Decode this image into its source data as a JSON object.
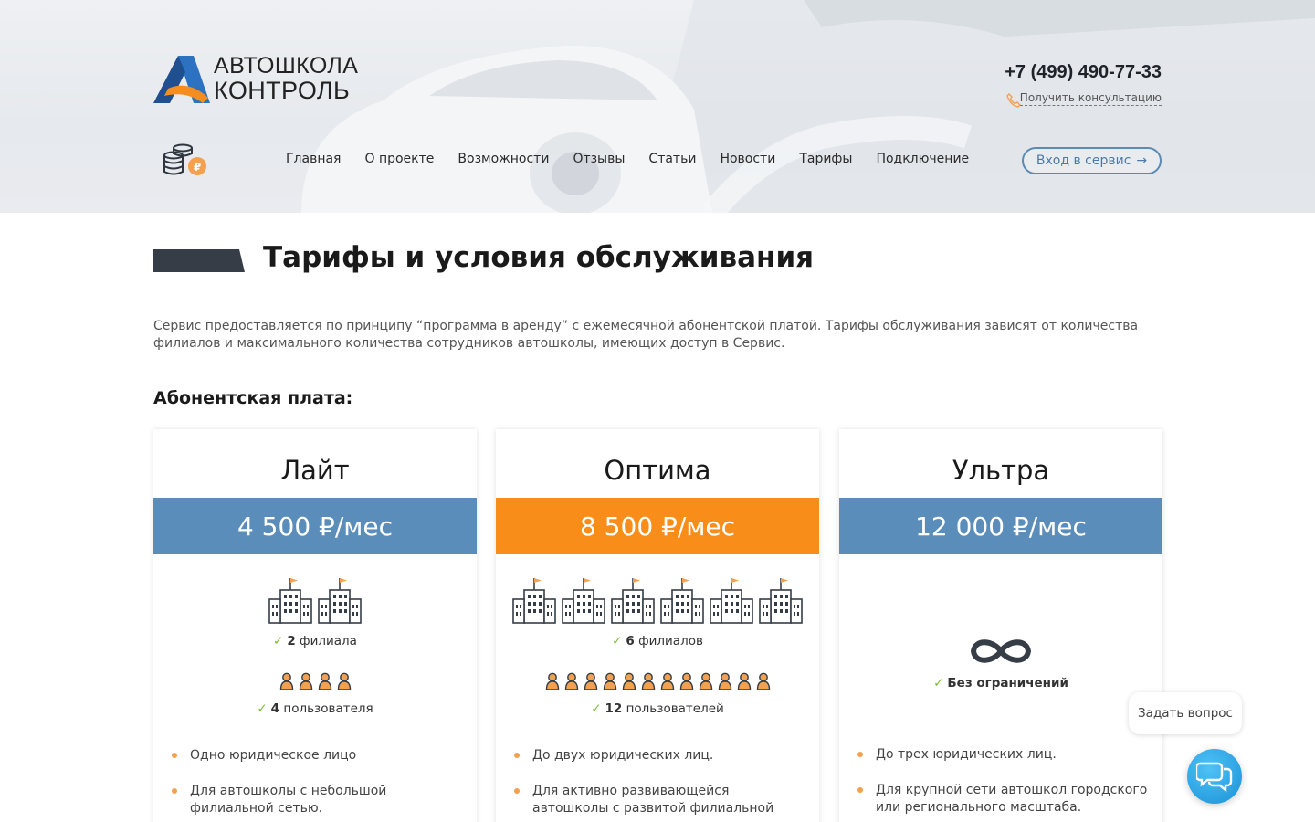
{
  "header": {
    "logo": {
      "line1": "АВТОШКОЛА",
      "line2": "КОНТРОЛЬ"
    },
    "phone": "+7 (499) 490-77-33",
    "consult_link": "Получить консультацию",
    "nav": [
      "Главная",
      "О проекте",
      "Возможности",
      "Отзывы",
      "Статьи",
      "Новости",
      "Тарифы",
      "Подключение"
    ],
    "login_button": "Вход в сервис"
  },
  "page": {
    "title": "Тарифы и условия обслуживания",
    "intro": "Сервис предоставляется по принципу “программа в аренду” с ежемесячной абонентской платой. Тарифы обслуживания зависят от количества филиалов и максимального количества сотрудников автошколы, имеющих доступ в Сервис.",
    "subtitle": "Абонентская плата:"
  },
  "plans": [
    {
      "name": "Лайт",
      "price": "4 500 ₽/мес",
      "price_color": "#5a8dba",
      "branches_count": "2",
      "branches_label": "филиала",
      "users_count": "4",
      "users_label": "пользователя",
      "bullets": [
        "Одно юридическое лицо",
        "Для автошколы с небольшой филиальной сетью."
      ]
    },
    {
      "name": "Оптима",
      "price": "8 500 ₽/мес",
      "price_color": "#f98d1a",
      "branches_count": "6",
      "branches_label": "филиалов",
      "users_count": "12",
      "users_label": "пользователей",
      "bullets": [
        "До двух юридических лиц.",
        "Для активно развивающейся автошколы с развитой филиальной сетью."
      ]
    },
    {
      "name": "Ультра",
      "price": "12 000 ₽/мес",
      "price_color": "#5a8dba",
      "unlimited_label": "Без ограничений",
      "bullets": [
        "До трех юридических лиц.",
        "Для крупной сети автошкол городского или регионального масштаба."
      ]
    }
  ],
  "chat": {
    "bubble_text": "Задать вопрос"
  },
  "colors": {
    "accent_blue": "#5a8dba",
    "accent_orange": "#f98d1a",
    "check_green": "#7dbb3a",
    "dark": "#363d47"
  }
}
